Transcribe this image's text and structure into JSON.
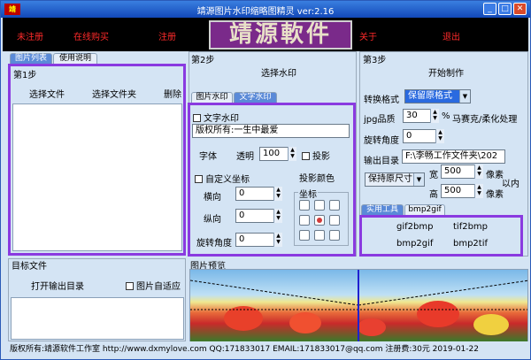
{
  "window": {
    "title": "靖源图片水印缩略图精灵 ver:2.16"
  },
  "menubar": {
    "items": [
      "未注册",
      "在线购买",
      "注册",
      "关于",
      "退出"
    ],
    "logo": "靖源軟件"
  },
  "left": {
    "tabs": [
      "图片列表",
      "使用说明"
    ],
    "step1": "第1步",
    "select_file": "选择文件",
    "select_folder": "选择文件夹",
    "delete": "删除",
    "target_title": "目标文件",
    "open_output": "打开输出目录",
    "auto_fit": "图片自适应"
  },
  "middle": {
    "step2": "第2步",
    "select_watermark": "选择水印",
    "tabs": [
      "图片水印",
      "文字水印"
    ],
    "text_watermark": "文字水印",
    "text_value": "版权所有:一生中最爱",
    "font": "字体",
    "opacity": "透明",
    "opacity_value": "100",
    "shadow": "投影",
    "custom_coords": "自定义坐标",
    "shadow_color": "投影颜色",
    "horizontal": "横向",
    "horizontal_value": "0",
    "vertical": "纵向",
    "vertical_value": "0",
    "coords": "坐标",
    "rotation": "旋转角度",
    "rotation_value": "0"
  },
  "right": {
    "step3": "第3步",
    "start": "开始制作",
    "convert_format": "转换格式",
    "format_value": "保留原格式",
    "jpg_quality": "jpg品质",
    "jpg_value": "30",
    "percent": "%",
    "mosaic": "马赛克/柔化处理",
    "rotate": "旋转角度",
    "rotate_value": "0",
    "output_dir": "输出目录",
    "output_value": "F:\\李畅工作文件夹\\202",
    "keep_size": "保持原尺寸",
    "width": "宽",
    "width_value": "500",
    "height": "高",
    "height_value": "500",
    "pixel": "像素",
    "within": "以内",
    "tool_tabs": [
      "实用工具",
      "bmp2gif"
    ],
    "tools": [
      "gif2bmp",
      "tif2bmp",
      "bmp2gif",
      "bmp2tif"
    ]
  },
  "preview": {
    "title": "图片预览"
  },
  "status": {
    "text": "版权所有:靖源软件工作室 http://www.dxmylove.com QQ:171833017 EMAIL:171833017@qq.com 注册费:30元 2019-01-22"
  },
  "colors": {
    "highlight": "#8a3ae0",
    "title_bar": "#1248b8",
    "menu_text": "#ff2a2a"
  }
}
